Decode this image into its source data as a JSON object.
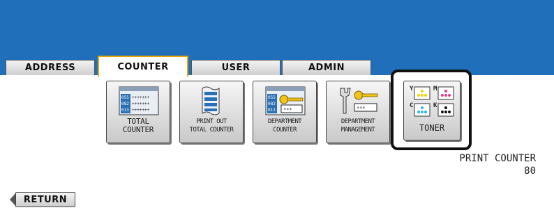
{
  "tabs": [
    {
      "label": "ADDRESS",
      "active": false
    },
    {
      "label": "COUNTER",
      "active": true
    },
    {
      "label": "USER",
      "active": false
    },
    {
      "label": "ADMIN",
      "active": false
    }
  ],
  "functions": {
    "total_counter": {
      "label": "TOTAL\nCOUNTER",
      "icon": "counter-table-icon"
    },
    "print_out_total_counter": {
      "label": "PRINT OUT\nTOTAL COUNTER",
      "icon": "printout-icon"
    },
    "department_counter": {
      "label": "DEPARTMENT\nCOUNTER",
      "icon": "department-key-icon"
    },
    "department_management": {
      "label": "DEPARTMENT\nMANAGEMENT",
      "icon": "wrench-key-icon"
    },
    "toner": {
      "label": "TONER",
      "icon": "toner-icon",
      "colors": [
        "Y",
        "M",
        "C",
        "K"
      ]
    }
  },
  "print_counter": {
    "label": "PRINT COUNTER",
    "value": "80"
  },
  "return_label": "RETURN",
  "colors": {
    "header_blue": "#1f6fba",
    "active_tab_border": "#e8a400",
    "yellow": "#f2d100",
    "magenta": "#e6398f",
    "cyan": "#2bb5e8",
    "black": "#111111"
  }
}
